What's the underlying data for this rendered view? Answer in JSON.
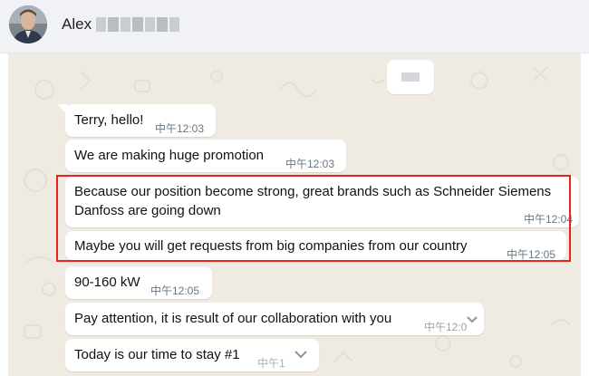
{
  "header": {
    "contact_name": "Alex"
  },
  "messages": [
    {
      "text": "Terry, hello!",
      "time": "中午12:03"
    },
    {
      "text": "We are making huge promotion",
      "time": "中午12:03"
    },
    {
      "line1": "Because our position become strong, great brands such as Schneider Siemens",
      "line2": "Danfoss are going down",
      "time": "中午12:04"
    },
    {
      "text": "Maybe you will get requests from big companies from our country",
      "time": "中午12:05"
    },
    {
      "text": "90-160 kW",
      "time": "中午12:05"
    },
    {
      "text": "Pay attention, it is result of our collaboration with you",
      "time": "中午12:0"
    },
    {
      "text": "Today is our time to stay #1",
      "time": "中午1"
    }
  ],
  "colors": {
    "chat_background": "#efeae2",
    "bubble": "#ffffff",
    "highlight_frame": "#e8221d",
    "timestamp": "#667781"
  },
  "icons": [
    "contact-avatar",
    "message-menu-chevron"
  ]
}
